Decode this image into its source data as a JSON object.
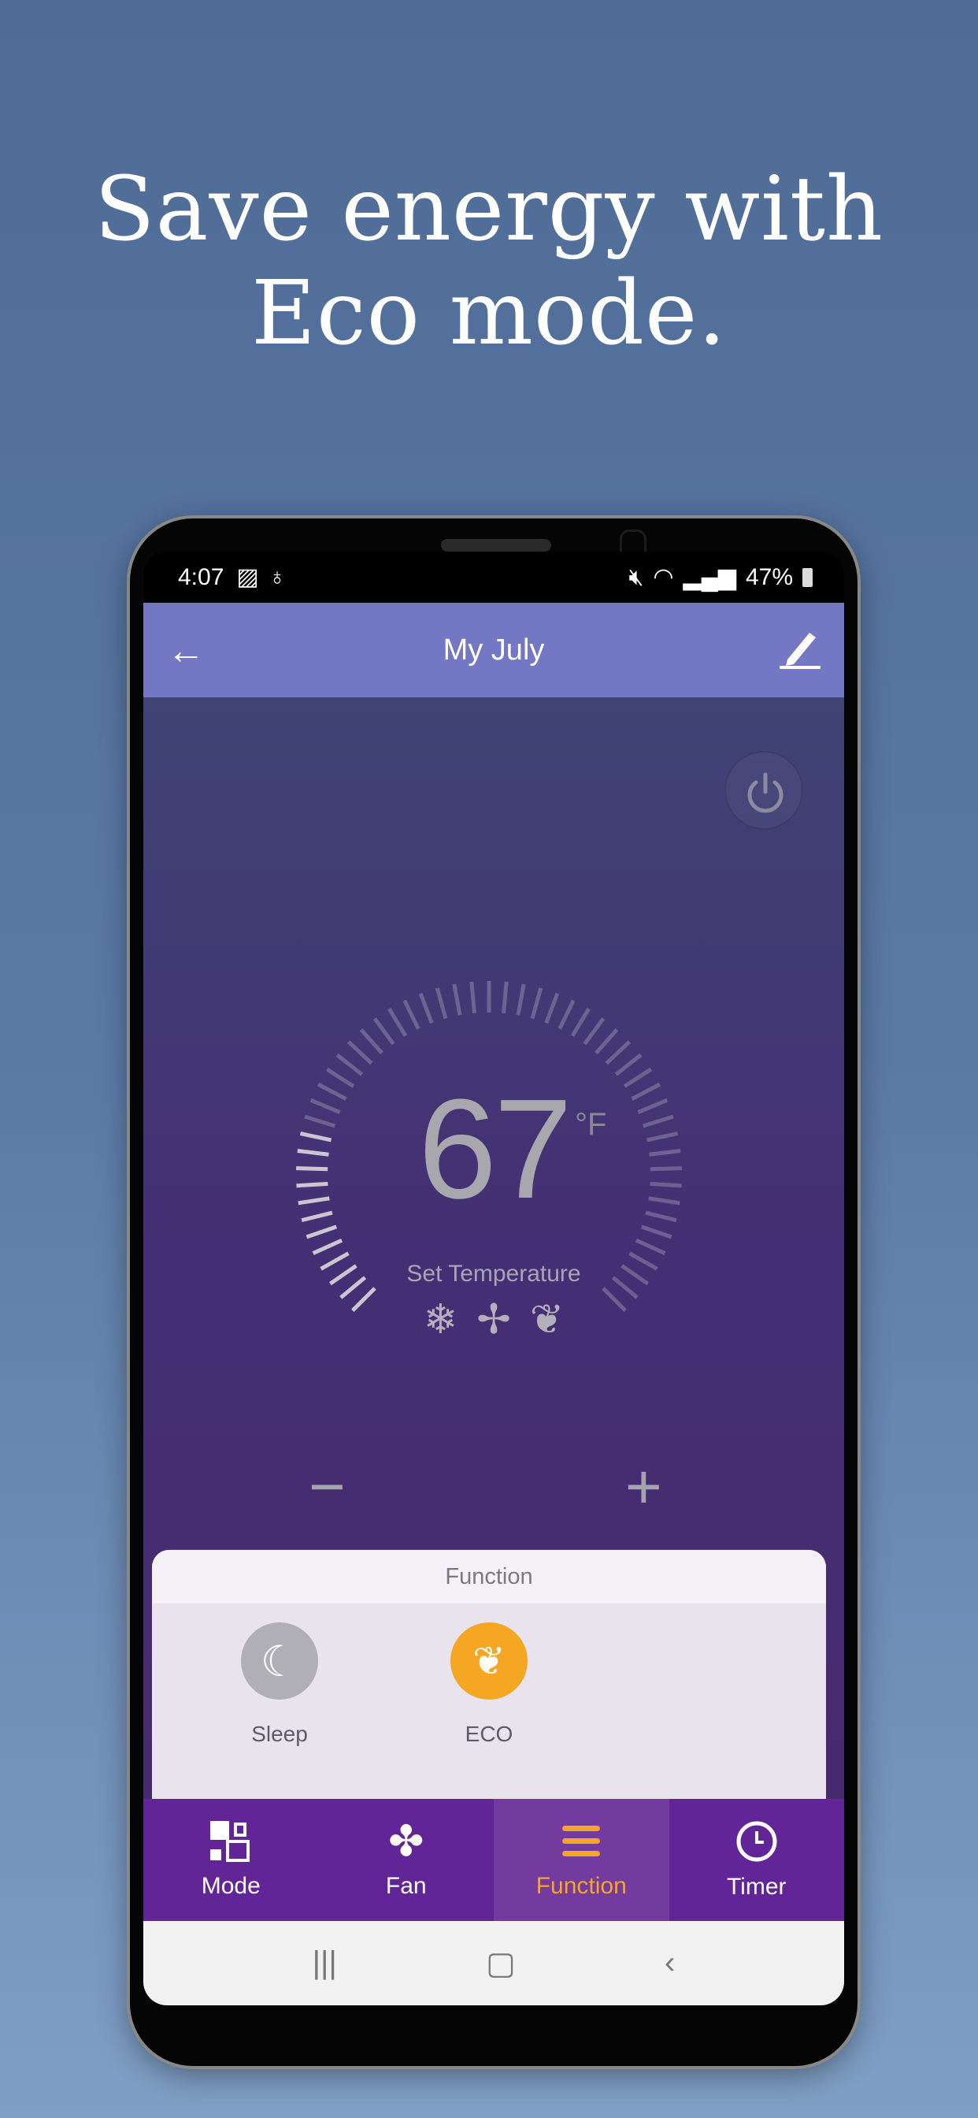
{
  "headline": {
    "line1": "Save energy with",
    "line2": "Eco mode."
  },
  "status_bar": {
    "time": "4:07",
    "battery": "47%"
  },
  "app_bar": {
    "title": "My July",
    "back_icon": "arrow-left-icon",
    "edit_icon": "pencil-icon"
  },
  "thermostat": {
    "temperature": "67",
    "unit": "°F",
    "label": "Set Temperature",
    "mode_icons": [
      "snowflake-icon",
      "fan-icon",
      "leaf-icon"
    ],
    "minus": "−",
    "plus": "+"
  },
  "function_sheet": {
    "title": "Function",
    "items": [
      {
        "label": "Sleep",
        "active": false,
        "color": "#b0aeb6"
      },
      {
        "label": "ECO",
        "active": true,
        "color": "#f5a623"
      }
    ]
  },
  "tabs": [
    {
      "label": "Mode"
    },
    {
      "label": "Fan"
    },
    {
      "label": "Function",
      "active": true
    },
    {
      "label": "Timer"
    }
  ],
  "colors": {
    "accent": "#f5a623",
    "app_bar": "#7377c4",
    "tab_bar": "#612597"
  }
}
